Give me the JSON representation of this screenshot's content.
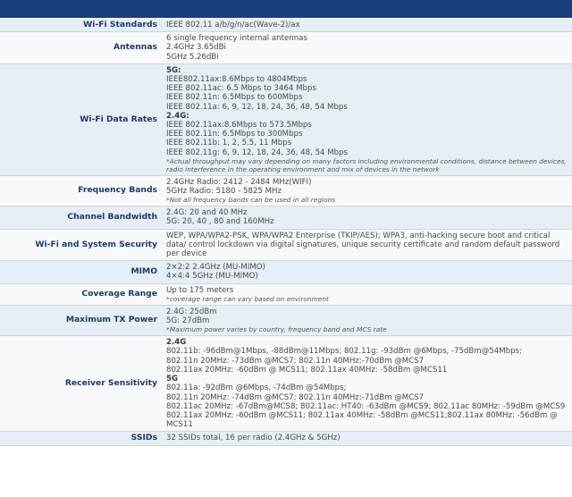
{
  "rows": [
    {
      "label": "Wi-Fi Standards",
      "lines": [
        {
          "t": "IEEE 802.11 a/b/g/n/ac(Wave-2)/ax",
          "k": "text"
        }
      ]
    },
    {
      "label": "Antennas",
      "lines": [
        {
          "t": "6 single frequency internal antennas",
          "k": "text"
        },
        {
          "t": "2.4GHz 3.65dBi",
          "k": "text"
        },
        {
          "t": "5GHz 5.26dBi",
          "k": "text"
        }
      ]
    },
    {
      "label": "Wi-Fi Data Rates",
      "lines": [
        {
          "t": "5G:",
          "k": "head"
        },
        {
          "t": "IEEE802.11ax:8.6Mbps to 4804Mbps",
          "k": "text"
        },
        {
          "t": "IEEE 802.11ac: 6.5 Mbps to 3464 Mbps",
          "k": "text"
        },
        {
          "t": "IEEE 802.11n: 6.5Mbps to 600Mbps",
          "k": "text"
        },
        {
          "t": "IEEE 802.11a: 6, 9, 12, 18, 24, 36, 48, 54 Mbps",
          "k": "text"
        },
        {
          "t": "2.4G:",
          "k": "head"
        },
        {
          "t": "IEEE 802.11ax:8.6Mbps to 573.5Mbps",
          "k": "text"
        },
        {
          "t": "IEEE 802.11n: 6.5Mbps to 300Mbps",
          "k": "text"
        },
        {
          "t": "IEEE 802.11b: 1, 2, 5.5, 11 Mbps",
          "k": "text"
        },
        {
          "t": "IEEE 802.11g: 6, 9, 12, 18, 24, 36, 48, 54 Mbps",
          "k": "text"
        },
        {
          "t": "*Actual throughput may vary depending on many factors including environmental conditions, distance between devices, radio interference in the operating environment and mix of devices in the network",
          "k": "note"
        }
      ]
    },
    {
      "label": "Frequency Bands",
      "lines": [
        {
          "t": "2.4GHz Radio: 2412 - 2484 MHz(WIFI)",
          "k": "text"
        },
        {
          "t": "5GHz Radio: 5180 - 5825 MHz",
          "k": "text"
        },
        {
          "t": "*Not all frequency bands can be used in all regions",
          "k": "note"
        }
      ]
    },
    {
      "label": "Channel Bandwidth",
      "lines": [
        {
          "t": "2.4G: 20 and 40 MHz",
          "k": "text"
        },
        {
          "t": "5G: 20, 40 , 80 and 160MHz",
          "k": "text"
        }
      ]
    },
    {
      "label": "Wi-Fi and System Security",
      "lines": [
        {
          "t": "WEP, WPA/WPA2-PSK, WPA/WPA2 Enterprise (TKIP/AES); WPA3, anti-hacking secure boot and critical data/ control lockdown via digital signatures, unique security certificate and random default password per device",
          "k": "wrap"
        }
      ]
    },
    {
      "label": "MIMO",
      "lines": [
        {
          "t": "2×2:2 2.4GHz (MU-MIMO)",
          "k": "text"
        },
        {
          "t": "4×4:4 5GHz (MU-MIMO)",
          "k": "text"
        }
      ]
    },
    {
      "label": "Coverage Range",
      "lines": [
        {
          "t": "Up to 175 meters",
          "k": "text"
        },
        {
          "t": "*coverage range can vary based on environment",
          "k": "note"
        }
      ]
    },
    {
      "label": "Maximum TX Power",
      "lines": [
        {
          "t": "2.4G: 25dBm",
          "k": "text"
        },
        {
          "t": "5G: 27dBm",
          "k": "text"
        },
        {
          "t": "*Maximum power varies by country, frequency band and MCS rate",
          "k": "note"
        }
      ]
    },
    {
      "label": "Receiver Sensitivity",
      "lines": [
        {
          "t": "2.4G",
          "k": "head"
        },
        {
          "t": "802.11b: -96dBm@1Mbps, -88dBm@11Mbps; 802.11g: -93dBm @6Mbps, -75dBm@54Mbps;",
          "k": "text"
        },
        {
          "t": "802.11n 20MHz: -73dBm @MCS7; 802.11n 40MHz:-70dBm @MCS7",
          "k": "text"
        },
        {
          "t": "802.11ax 20MHz: -60dBm @ MCS11; 802.11ax 40MHz: -58dBm @MCS11",
          "k": "text"
        },
        {
          "t": "5G",
          "k": "head"
        },
        {
          "t": "802.11a: -92dBm @6Mbps, -74dBm @54Mbps;",
          "k": "text"
        },
        {
          "t": "802.11n 20MHz: -74dBm @MCS7; 802.11n 40MHz:-71dBm @MCS7",
          "k": "text"
        },
        {
          "t": "802.11ac 20MHz: -67dBm@MCS8; 802.11ac: HT40: -63dBm @MCS9; 802.11ac 80MHz: -59dBm @MCS9",
          "k": "text"
        },
        {
          "t": "802.11ax 20MHz: -60dBm @MCS11; 802.11ax 40MHz: -58dBm @MCS11;802.11ax 80MHz: -56dBm @",
          "k": "text"
        },
        {
          "t": "MCS11",
          "k": "text"
        }
      ]
    },
    {
      "label": "SSIDs",
      "lines": [
        {
          "t": "32 SSIDs total, 16 per radio (2.4GHz & 5GHz)",
          "k": "text"
        }
      ]
    }
  ]
}
